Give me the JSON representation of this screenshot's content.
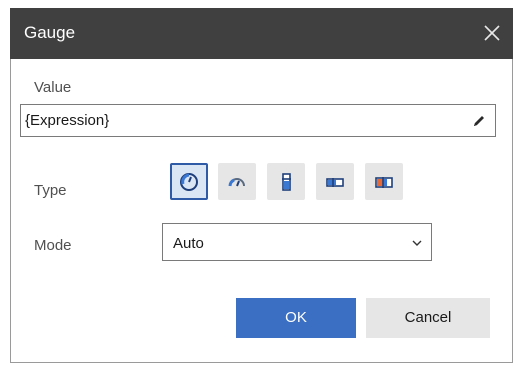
{
  "dialog": {
    "title": "Gauge",
    "close_icon": "close-icon"
  },
  "value": {
    "label": "Value",
    "field_value": "{Expression}",
    "edit_icon": "pencil-icon"
  },
  "type": {
    "label": "Type",
    "options": [
      {
        "icon": "gauge-full-circle-icon",
        "selected": true
      },
      {
        "icon": "gauge-half-circle-icon",
        "selected": false
      },
      {
        "icon": "gauge-vertical-linear-icon",
        "selected": false
      },
      {
        "icon": "gauge-horizontal-linear-icon",
        "selected": false
      },
      {
        "icon": "gauge-bullet-icon",
        "selected": false
      }
    ]
  },
  "mode": {
    "label": "Mode",
    "selected": "Auto"
  },
  "buttons": {
    "ok_label": "OK",
    "cancel_label": "Cancel"
  },
  "colors": {
    "titlebar": "#404040",
    "accent": "#3b6fc4",
    "selected_border": "#2f5aa6"
  }
}
